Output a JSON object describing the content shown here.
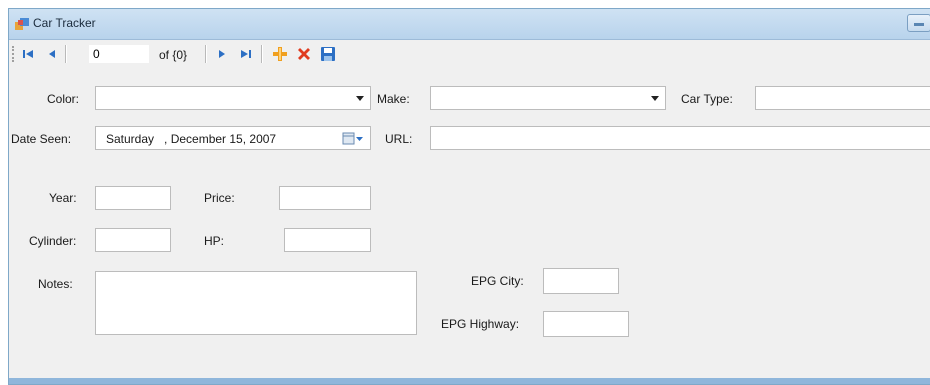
{
  "window": {
    "title": "Car Tracker"
  },
  "navigator": {
    "position": "0",
    "count_text": "of {0}"
  },
  "fields": {
    "color_label": "Color:",
    "color_value": "",
    "make_label": "Make:",
    "make_value": "",
    "car_type_label": "Car Type:",
    "car_type_value": "",
    "date_seen_label": "Date Seen:",
    "date_seen_value": "Saturday   , December 15, 2007",
    "url_label": "URL:",
    "url_value": "",
    "year_label": "Year:",
    "price_label": "Price:",
    "cylinder_label": "Cylinder:",
    "hp_label": "HP:",
    "notes_label": "Notes:",
    "epg_city_label": "EPG City:",
    "epg_highway_label": "EPG Highway:"
  },
  "colors": {
    "title_bar": "#b8d3ec",
    "form_bg": "#f0f0f0",
    "delete_red": "#e03a1e",
    "add_orange": "#f0a020",
    "nav_blue": "#2c6fc4"
  }
}
